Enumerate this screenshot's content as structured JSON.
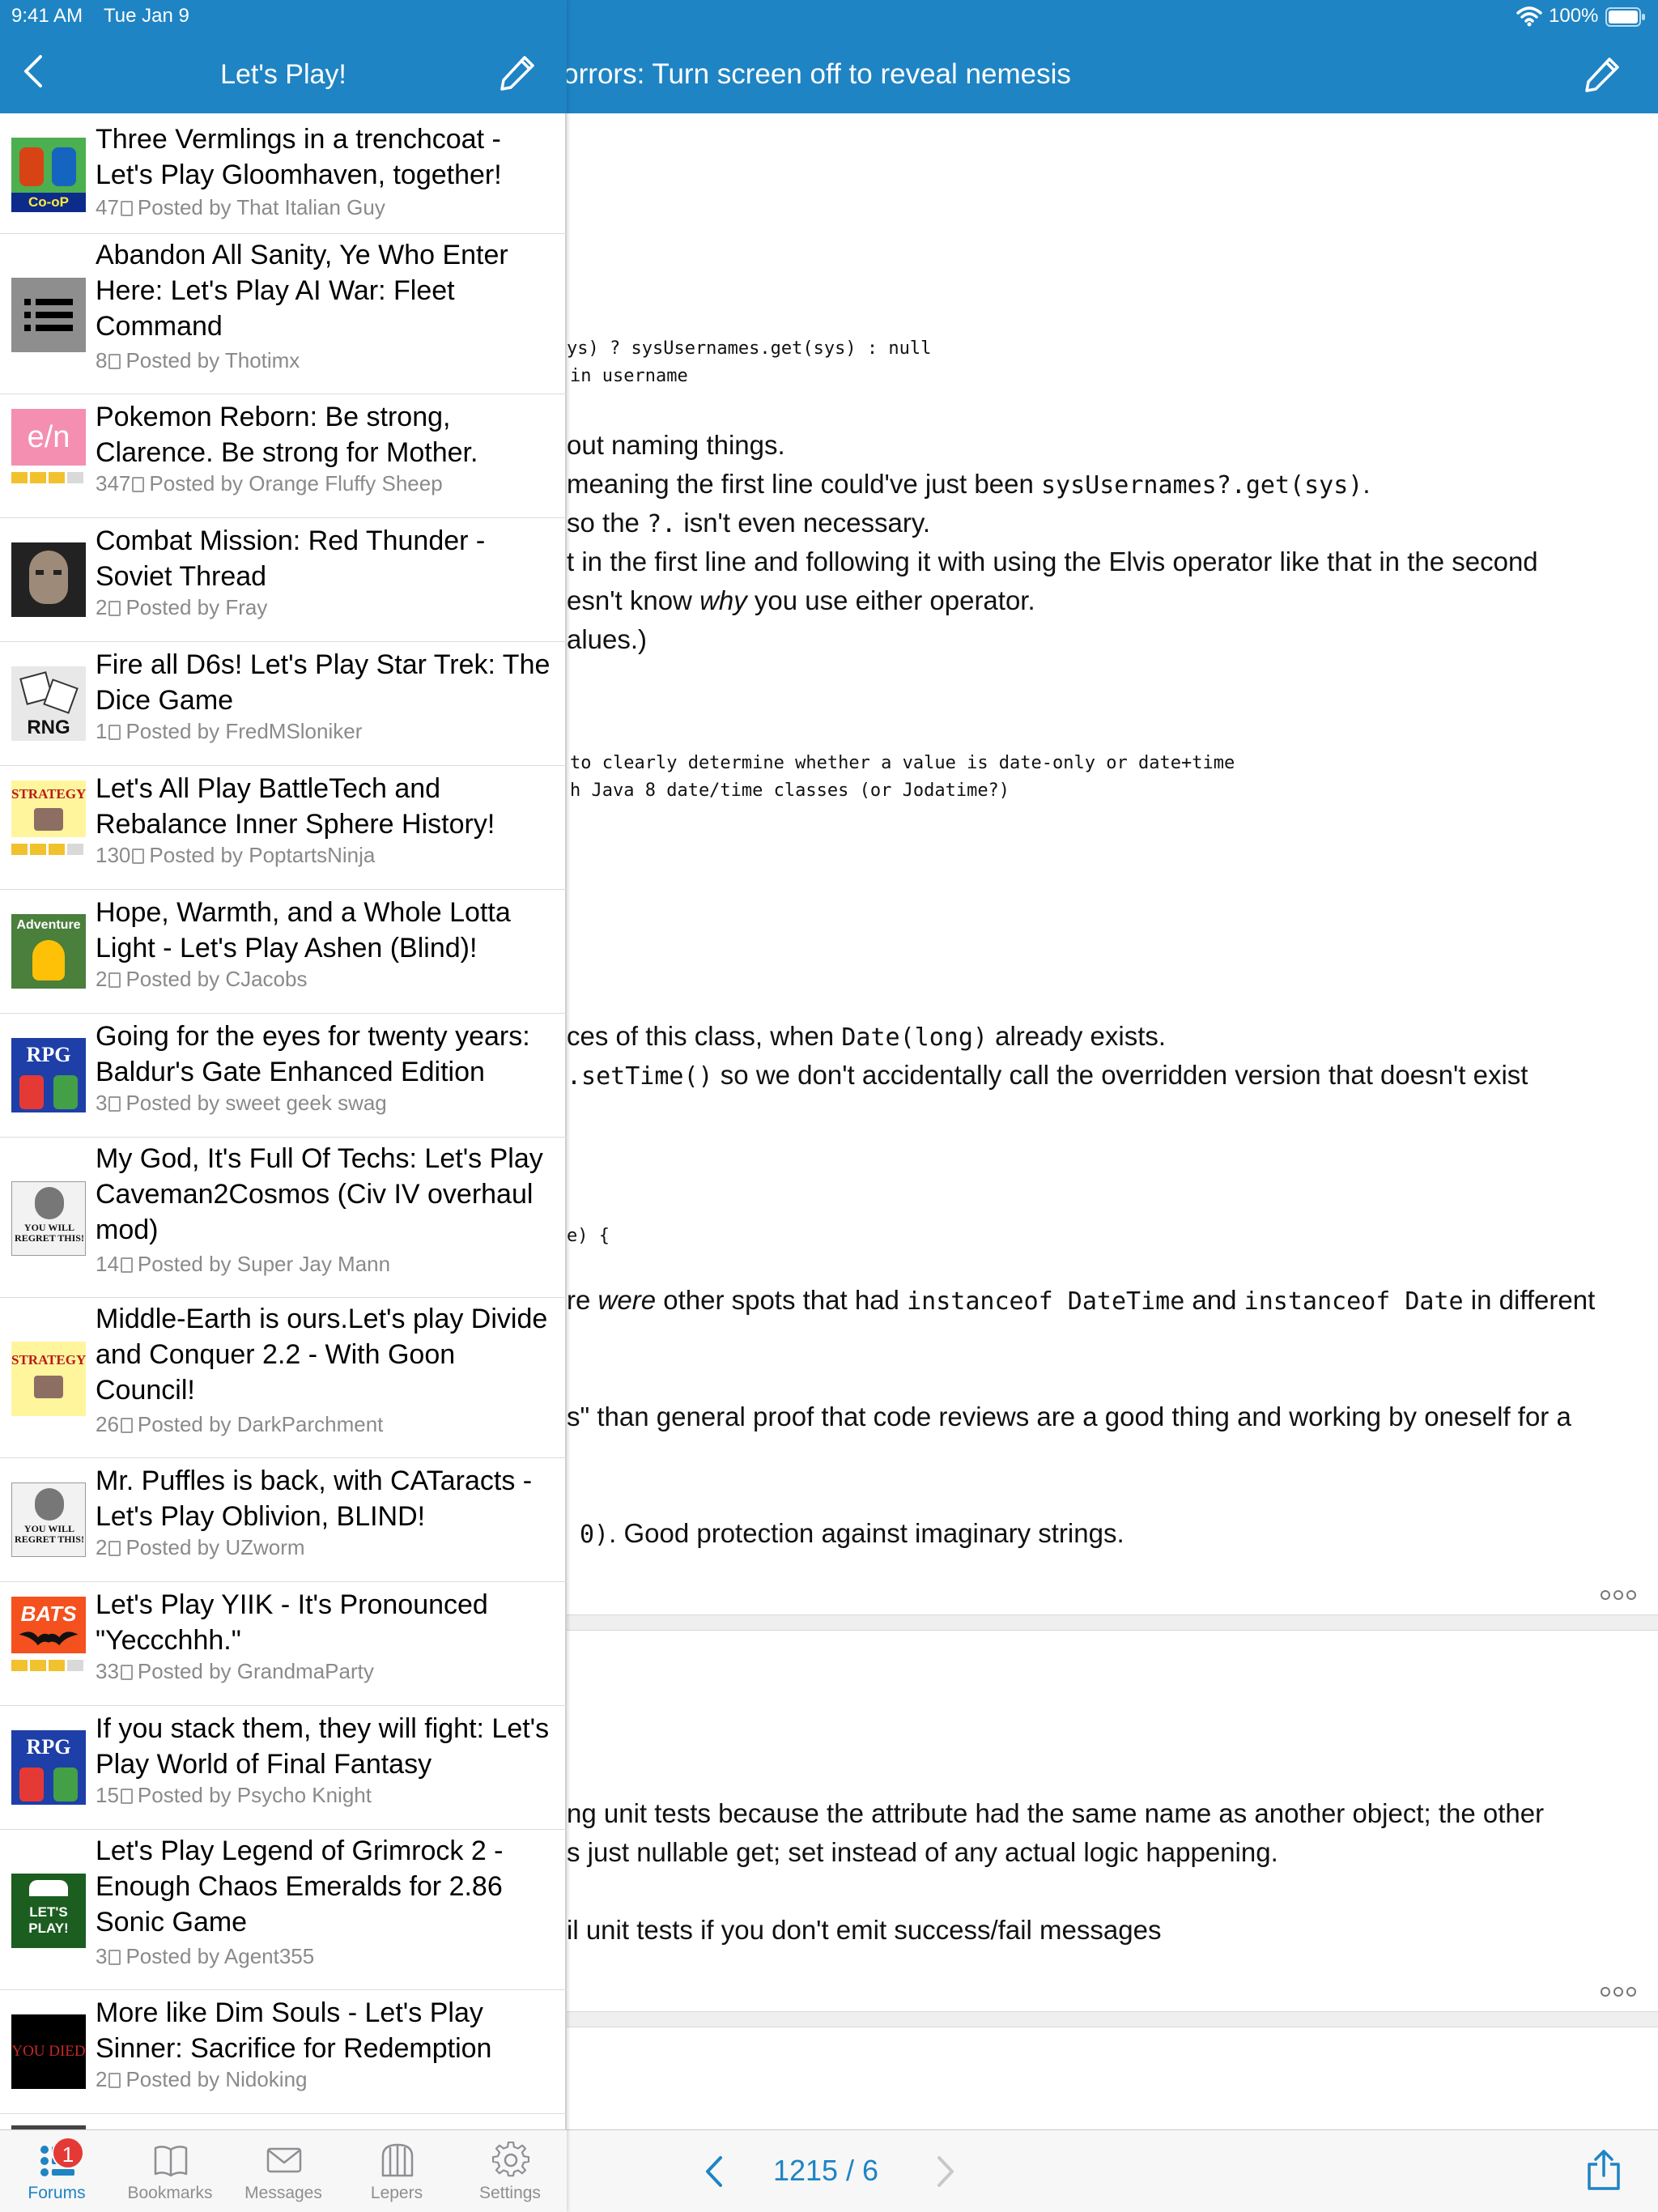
{
  "status_bar": {
    "time": "9:41 AM",
    "date": "Tue Jan 9",
    "battery": "100%"
  },
  "master": {
    "title": "Let's Play!"
  },
  "threads": [
    {
      "title": "Three Vermlings in a trenchcoat - Let's Play Gloomhaven, together!",
      "pages": "47",
      "author": "Posted by That Italian Guy",
      "tag": "Co-oP",
      "rating": 0
    },
    {
      "title": "Abandon All Sanity, Ye Who Enter Here: Let's Play AI War: Fleet Command",
      "pages": "8",
      "author": "Posted by Thotimx",
      "tag": "list",
      "rating": 0
    },
    {
      "title": "Pokemon Reborn: Be strong, Clarence. Be strong for Mother.",
      "pages": "347",
      "author": "Posted by Orange Fluffy Sheep",
      "tag": "e/n",
      "rating": 4
    },
    {
      "title": "Combat Mission: Red Thunder - Soviet Thread",
      "pages": "2",
      "author": "Posted by Fray",
      "tag": "face",
      "rating": 0
    },
    {
      "title": "Fire all D6s! Let's Play Star Trek: The Dice Game",
      "pages": "1",
      "author": "Posted by FredMSloniker",
      "tag": "RNG",
      "rating": 0
    },
    {
      "title": "Let's All Play BattleTech and Rebalance Inner Sphere History!",
      "pages": "130",
      "author": "Posted by PoptartsNinja",
      "tag": "STRATEGY",
      "rating": 4
    },
    {
      "title": "Hope, Warmth, and a Whole Lotta Light - Let's Play Ashen (Blind)!",
      "pages": "2",
      "author": "Posted by CJacobs",
      "tag": "Adventure",
      "rating": 0
    },
    {
      "title": "Going for the eyes for twenty years: Baldur's Gate Enhanced Edition",
      "pages": "3",
      "author": "Posted by sweet geek swag",
      "tag": "RPG",
      "rating": 0
    },
    {
      "title": "My God, It's Full Of Techs: Let's Play Caveman2Cosmos (Civ IV overhaul mod)",
      "pages": "14",
      "author": "Posted by Super Jay Mann",
      "tag": "YOU WILL REGRET THIS!",
      "rating": 0
    },
    {
      "title": "Middle-Earth is ours.Let's play Divide and Conquer 2.2 - With Goon Council!",
      "pages": "26",
      "author": "Posted by DarkParchment",
      "tag": "STRATEGY",
      "rating": 0
    },
    {
      "title": "Mr. Puffles is back, with CATaracts - Let's Play Oblivion, BLIND!",
      "pages": "2",
      "author": "Posted by UZworm",
      "tag": "YOU WILL REGRET THIS!",
      "rating": 0
    },
    {
      "title": "Let's Play YIIK - It's Pronounced \"Yeccchhh.\"",
      "pages": "33",
      "author": "Posted by GrandmaParty",
      "tag": "BATS",
      "rating": 4
    },
    {
      "title": "If you stack them, they will fight: Let's Play World of Final Fantasy",
      "pages": "15",
      "author": "Posted by Psycho Knight",
      "tag": "RPG",
      "rating": 0
    },
    {
      "title": "Let's Play Legend of Grimrock 2 - Enough Chaos Emeralds for 2.86 Sonic Game",
      "pages": "3",
      "author": "Posted by Agent355",
      "tag": "LET'S PLAY!",
      "rating": 0
    },
    {
      "title": "More like Dim Souls - Let's Play Sinner: Sacrifice for Redemption",
      "pages": "2",
      "author": "Posted by Nidoking",
      "tag": "YOU DIED",
      "rating": 0
    }
  ],
  "tabs": [
    {
      "label": "Forums",
      "badge": "1"
    },
    {
      "label": "Bookmarks"
    },
    {
      "label": "Messages"
    },
    {
      "label": "Lepers"
    },
    {
      "label": "Settings"
    }
  ],
  "detail": {
    "title": "ding Horrors: Turn screen off to reveal nemesis",
    "code_lines": [
      "ys) ? sysUsernames.get(sys) : null",
      "in username",
      "to clearly determine whether a value is date-only or date+time",
      "h Java 8 date/time classes (or Jodatime?)",
      "e) {"
    ],
    "lines": [
      "out naming things.",
      "meaning the first line could've just been ",
      "sysUsernames?.get(sys)",
      ".",
      "so the ",
      "?.",
      " isn't even necessary.",
      "t in the first line and following it with using the Elvis operator like that in the second",
      "esn't know ",
      "why",
      " you use either operator.",
      "alues.)",
      "ces of this class, when ",
      "Date(long)",
      " already exists.",
      ".setTime()",
      " so we don't accidentally call the overridden version that doesn't exist",
      "re ",
      "were",
      " other spots that had ",
      "instanceof DateTime",
      " and ",
      "instanceof Date",
      " in different",
      "s\" than general proof that code reviews are a good thing and working by oneself for a",
      "0)",
      ". Good protection against imaginary strings.",
      "ng unit tests because the attribute had the same name as another object; the other",
      "s just nullable get; set instead of any actual logic happening.",
      "il unit tests if you don't emit success/fail messages"
    ],
    "page_counter": "1215 / 6"
  },
  "colors": {
    "accent": "#1e84c4",
    "badge": "#e53935",
    "rating": "#f2c12e"
  }
}
